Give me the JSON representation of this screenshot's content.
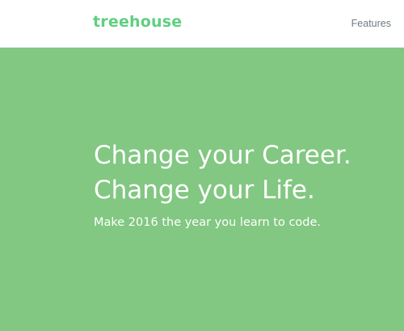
{
  "header": {
    "logo_text": "treehouse",
    "nav": {
      "features_label": "Features"
    }
  },
  "hero": {
    "headline_line1": "Change your Career.",
    "headline_line2": "Change your Life.",
    "subheadline": "Make 2016 the year you learn to code."
  },
  "colors": {
    "brand_green": "#5fcf80",
    "hero_background": "#82c782",
    "nav_text": "#6e7c82",
    "hero_text": "#ffffff"
  }
}
